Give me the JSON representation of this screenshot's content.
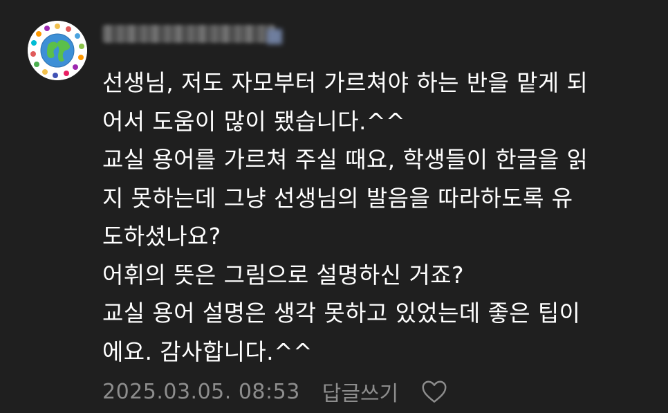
{
  "comment": {
    "avatar_icon": "earth-globe-with-children-icon",
    "username_obscured": true,
    "body_lines": [
      "선생님, 저도 자모부터 가르쳐야 하는 반을 맡게 되",
      "어서 도움이 많이 됐습니다.^^",
      "교실 용어를 가르쳐 주실 때요, 학생들이 한글을 읽",
      "지 못하는데 그냥 선생님의 발음을 따라하도록 유",
      "도하셨나요?",
      "어휘의 뜻은 그림으로 설명하신 거죠?",
      "교실 용어 설명은 생각 못하고 있었는데 좋은 팁이",
      "에요. 감사합니다.^^"
    ],
    "timestamp": "2025.03.05. 08:53",
    "reply_label": "답글쓰기",
    "like_icon": "heart-outline-icon"
  },
  "colors": {
    "background": "#1f1f1f",
    "text": "#ffffff",
    "meta_text": "#8d8d8d"
  }
}
